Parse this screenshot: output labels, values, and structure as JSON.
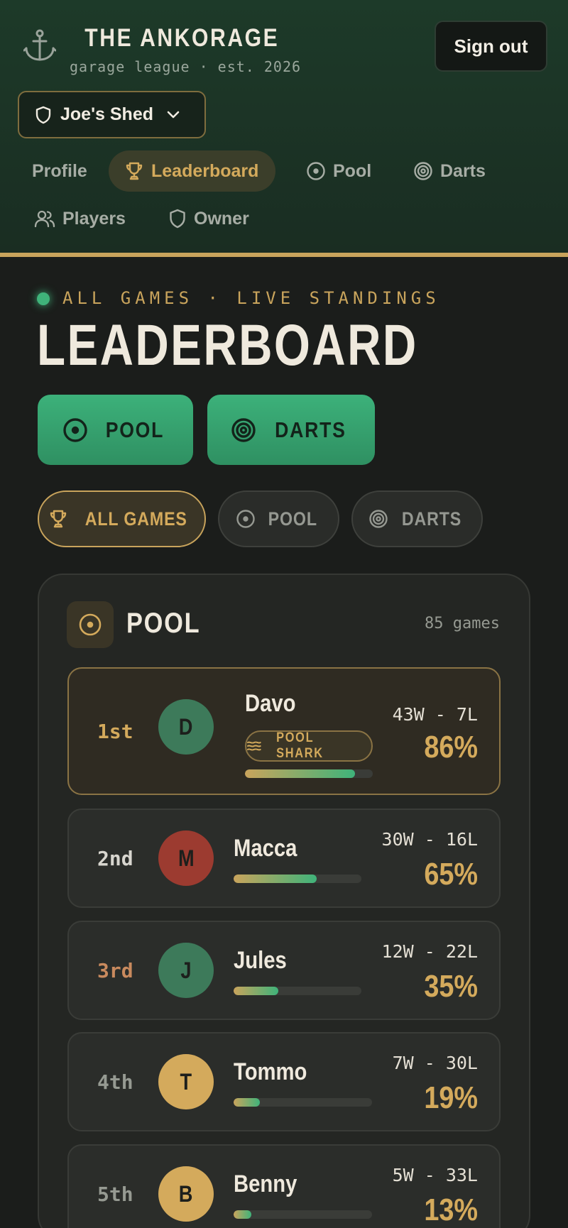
{
  "brand": {
    "title": "THE ANKORAGE",
    "subtitle": "garage league · est. 2026"
  },
  "header": {
    "signout_label": "Sign out",
    "venue": "Joe's Shed"
  },
  "nav": [
    {
      "label": "Profile",
      "icon": "none",
      "active": false
    },
    {
      "label": "Leaderboard",
      "icon": "trophy-icon",
      "active": true
    },
    {
      "label": "Pool",
      "icon": "target-icon",
      "active": false
    },
    {
      "label": "Darts",
      "icon": "bullseye-icon",
      "active": false
    },
    {
      "label": "Players",
      "icon": "users-icon",
      "active": false
    },
    {
      "label": "Owner",
      "icon": "shield-icon",
      "active": false
    }
  ],
  "main": {
    "kicker": "ALL GAMES · LIVE STANDINGS",
    "title": "LEADERBOARD",
    "game_buttons": [
      "POOL",
      "DARTS"
    ],
    "filters": [
      {
        "label": "ALL GAMES",
        "active": true
      },
      {
        "label": "POOL",
        "active": false
      },
      {
        "label": "DARTS",
        "active": false
      }
    ]
  },
  "card": {
    "title": "POOL",
    "games": "85 games",
    "rows": [
      {
        "rank": "1st",
        "initial": "D",
        "name": "Davo",
        "record": "43W - 7L",
        "pct": "86%",
        "win_rate": 0.86,
        "badge": "POOL SHARK",
        "avatar_color": "#3d7a5a",
        "rank_color": "#d4aa5c"
      },
      {
        "rank": "2nd",
        "initial": "M",
        "name": "Macca",
        "record": "30W - 16L",
        "pct": "65%",
        "win_rate": 0.65,
        "avatar_color": "#9c3b30",
        "rank_color": "#d8d6cf"
      },
      {
        "rank": "3rd",
        "initial": "J",
        "name": "Jules",
        "record": "12W - 22L",
        "pct": "35%",
        "win_rate": 0.35,
        "avatar_color": "#3d7a5a",
        "rank_color": "#c98a5e"
      },
      {
        "rank": "4th",
        "initial": "T",
        "name": "Tommo",
        "record": "7W - 30L",
        "pct": "19%",
        "win_rate": 0.19,
        "avatar_color": "#d4aa5c",
        "rank_color": "#969a92"
      },
      {
        "rank": "5th",
        "initial": "B",
        "name": "Benny",
        "record": "5W - 33L",
        "pct": "13%",
        "win_rate": 0.13,
        "avatar_color": "#d4aa5c",
        "rank_color": "#969a92"
      }
    ]
  }
}
